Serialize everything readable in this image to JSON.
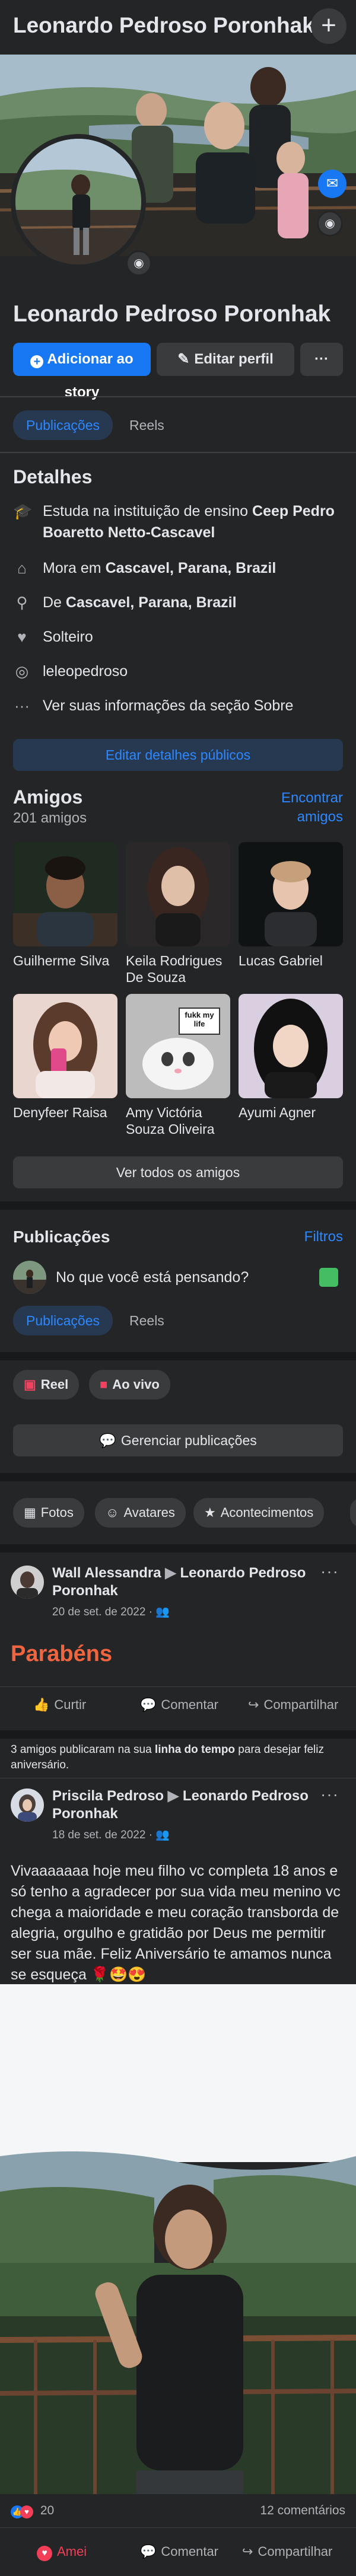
{
  "top_bar": {
    "title": "Leonardo Pedroso Poronhak",
    "plus_icon": "plus-icon"
  },
  "profile": {
    "name": "Leonardo Pedroso Poronhak",
    "add_story_label": "Adicionar ao story",
    "edit_profile_label": "Editar perfil",
    "more_label": "···"
  },
  "tabs": {
    "posts": "Publicações",
    "reels": "Reels"
  },
  "details": {
    "title": "Detalhes",
    "study_prefix": "Estuda na instituição de ensino ",
    "study_place": "Ceep Pedro Boaretto Netto-Cascavel",
    "lives_prefix": "Mora em ",
    "lives_place": "Cascavel, Parana, Brazil",
    "from_prefix": "De ",
    "from_place": "Cascavel, Parana, Brazil",
    "relationship": "Solteiro",
    "instagram": "leleopedroso",
    "about_link": "Ver suas informações da seção Sobre",
    "edit_button": "Editar detalhes públicos"
  },
  "friends": {
    "title": "Amigos",
    "count": "201 amigos",
    "find_link_line1": "Encontrar",
    "find_link_line2": "amigos",
    "list": [
      {
        "name": "Guilherme Silva"
      },
      {
        "name": "Keila Rodrigues De Souza"
      },
      {
        "name": "Lucas Gabriel"
      },
      {
        "name": "Denyfeer Raisa"
      },
      {
        "name": "Amy Victória Souza Oliveira"
      },
      {
        "name": "Ayumi Agner"
      }
    ],
    "meme_text": "fukk my life",
    "see_all": "Ver todos os amigos"
  },
  "posts_section": {
    "title": "Publicações",
    "filters": "Filtros",
    "composer_placeholder": "No que você está pensando?",
    "reel_label": "Reel",
    "live_label": "Ao vivo",
    "manage_label": "Gerenciar publicações"
  },
  "albums": {
    "photos": "Fotos",
    "avatars": "Avatares",
    "highlights": "Acontecimentos"
  },
  "post1": {
    "author": "Wall Alessandra",
    "arrow": "▶",
    "target": "Leonardo Pedroso Poronhak",
    "date": "20 de set. de 2022",
    "body": "Parabéns",
    "like": "Curtir",
    "comment": "Comentar",
    "share": "Compartilhar"
  },
  "timeline_notice": {
    "prefix": "3 amigos publicaram na sua ",
    "link": "linha do tempo",
    "suffix": " para desejar feliz aniversário."
  },
  "post2": {
    "author": "Priscila Pedroso",
    "arrow": "▶",
    "target": "Leonardo Pedroso Poronhak",
    "date": "18 de set. de 2022",
    "body": "Vivaaaaaaa hoje meu filho vc completa 18 anos e só tenho a agradecer por sua vida meu menino vc chega a maioridade e meu coração transborda de alegria, orgulho e gratidão por Deus me permitir ser sua mãe. Feliz Aniversário te amamos nunca se esqueça 🌹🤩😍",
    "reactions_count": "20",
    "comments_count": "12 comentários",
    "loved": "Amei",
    "comment": "Comentar",
    "share": "Compartilhar"
  },
  "colors": {
    "background": "#242526",
    "accent": "#1877f2",
    "link": "#2d88ff",
    "parabens": "#f0653f"
  }
}
